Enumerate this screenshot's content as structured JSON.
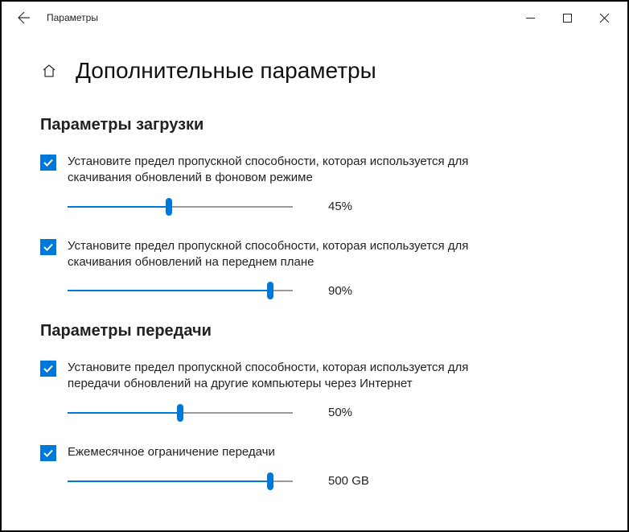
{
  "window": {
    "app_title": "Параметры"
  },
  "page": {
    "title": "Дополнительные параметры"
  },
  "sections": {
    "download": {
      "title": "Параметры загрузки",
      "opt1": {
        "label": "Установите предел пропускной способности, которая используется для скачивания обновлений в фоновом режиме",
        "value_pct": 45,
        "value_label": "45%"
      },
      "opt2": {
        "label": "Установите предел пропускной способности, которая используется для скачивания обновлений на переднем плане",
        "value_pct": 90,
        "value_label": "90%"
      }
    },
    "upload": {
      "title": "Параметры передачи",
      "opt1": {
        "label": "Установите предел пропускной способности, которая используется для передачи обновлений на другие компьютеры через Интернет",
        "value_pct": 50,
        "value_label": "50%"
      },
      "opt2": {
        "label": "Ежемесячное ограничение передачи",
        "value_pct": 90,
        "value_label": "500 GB"
      }
    }
  }
}
